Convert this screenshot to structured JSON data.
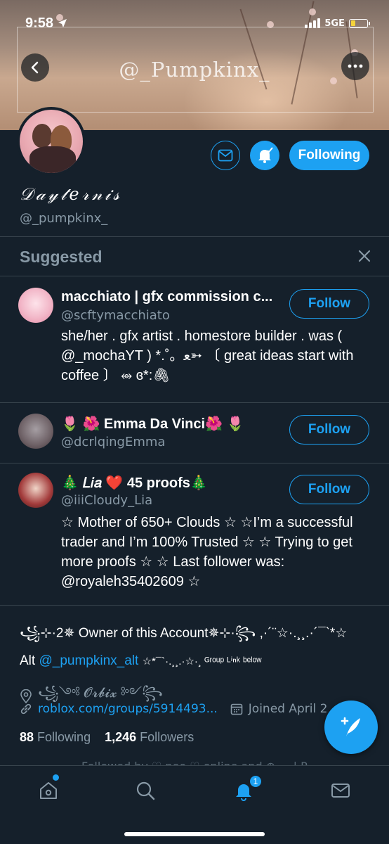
{
  "status_bar": {
    "time": "9:58",
    "network": "5GE"
  },
  "banner": {
    "title": "@_Pumpkinx_"
  },
  "profile": {
    "following_button": "Following",
    "display_name": "𝒟𝒶𝓎𝓉𝑒𝓇𝓃𝒾𝓈",
    "handle": "@_pumpkinx_",
    "bio_line1": "꧁⊹·2✵ Owner of this Account✵⊹·꧂ ,·´¨☆·.¸¸.·´¯`*☆",
    "bio_alt_prefix": "Alt",
    "bio_alt_handle": "@_pumpkinx_alt",
    "bio_alt_suffix": "☆*¯`·.¸¸.·☆·¸ ᴳʳᵒᵘᵖ ᴸⁱⁿᵏ ᵇᵉˡᵒʷ",
    "location": "꧁༺ 𝓞𝓻𝓫𝓲𝔁 ༻꧂",
    "website": "roblox.com/groups/5914493...",
    "joined": "Joined April 2",
    "following_count": "88",
    "following_label": "Following",
    "followers_count": "1,246",
    "followers_label": "Followers",
    "followed_by": "Followed by ♡ neo ♡ online and ⊕ · · | P"
  },
  "suggested": {
    "title": "Suggested",
    "items": [
      {
        "name": "macchiato | gfx commission c...",
        "username": "@scftymacchiato",
        "bio": "she/her . gfx artist . homestore builder . was ( @_mochaYT ) *.˚。ﻌ➳ 〔 great ideas start with coffee 〕 ⥈ ɞ*:🖇",
        "button": "Follow"
      },
      {
        "name": "🌷 🌺 Emma Da Vinci🌺 🌷",
        "username": "@dcrlqingEmma",
        "bio": "",
        "button": "Follow"
      },
      {
        "name": "🎄 𝐿𝑖𝑎 ❤️ 45 proofs🎄",
        "username": "@iiiCloudy_Lia",
        "bio": "☆ Mother of 650+ Clouds ☆ ☆I’m a successful trader and I’m 100% Trusted ☆ ☆ Trying to get more proofs ☆ ☆ Last follower was: @royaleh35402609 ☆",
        "button": "Follow"
      }
    ]
  },
  "tabbar": {
    "notifications_badge": "1"
  },
  "colors": {
    "background": "#15202b",
    "accent": "#1da1f2",
    "secondary_text": "#8899a6",
    "divider": "#38444d"
  },
  "icons": [
    "location-arrow-icon",
    "back-icon",
    "more-icon",
    "mail-icon",
    "bell-check-icon",
    "close-icon",
    "location-icon",
    "link-icon",
    "calendar-icon",
    "compose-icon",
    "home-icon",
    "search-icon",
    "notifications-icon",
    "messages-icon"
  ]
}
